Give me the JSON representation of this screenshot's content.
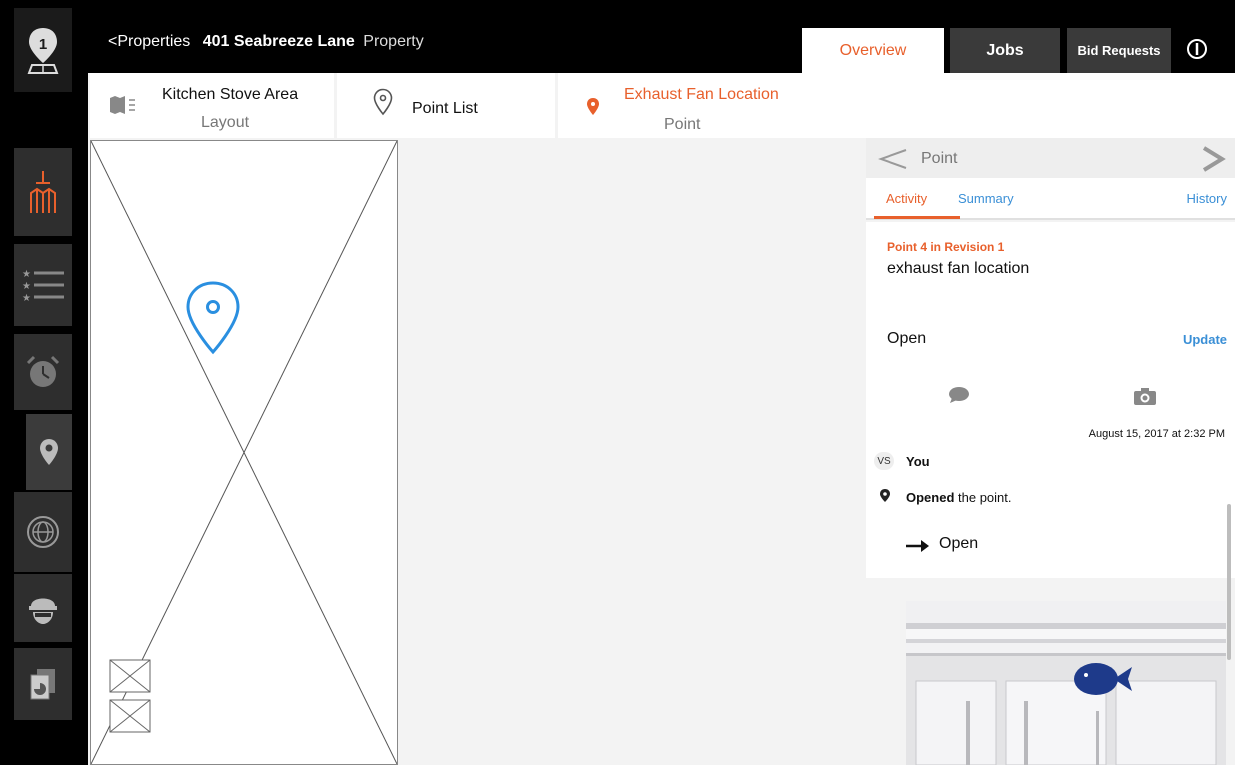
{
  "header": {
    "back_label": "Properties",
    "property_name": "401 Seabreeze Lane",
    "property_kind": "Property",
    "tabs": {
      "overview": "Overview",
      "jobs": "Jobs",
      "bid_requests": "Bid Requests"
    }
  },
  "sidebar": {
    "items": [
      {
        "icon": "pin-map-logo-icon"
      },
      {
        "icon": "building-plan-icon"
      },
      {
        "icon": "starred-list-icon"
      },
      {
        "icon": "alarm-clock-icon"
      },
      {
        "icon": "location-pin-icon"
      },
      {
        "icon": "globe-icon"
      },
      {
        "icon": "hardhat-worker-icon"
      },
      {
        "icon": "documents-icon"
      }
    ]
  },
  "subnav": {
    "layout": {
      "title": "Kitchen Stove Area",
      "subtitle": "Layout"
    },
    "point_list": {
      "title": "Point List"
    },
    "point": {
      "title": "Exhaust Fan Location",
      "subtitle": "Point"
    }
  },
  "panel": {
    "title": "Point",
    "tabs": {
      "activity": "Activity",
      "summary": "Summary",
      "history": "History"
    },
    "point_revision": "Point 4 in Revision 1",
    "point_description": "exhaust fan location",
    "status": "Open",
    "update_label": "Update",
    "timestamp": "August 15, 2017 at 2:32 PM",
    "user_initials": "VS",
    "user_name": "You",
    "activity": {
      "action": "Opened",
      "rest": " the point.",
      "new_status": "Open"
    }
  },
  "colors": {
    "accent": "#e8602c",
    "link": "#3a8fd6",
    "pin": "#2a8fe0",
    "background": "#f3f3f3"
  }
}
